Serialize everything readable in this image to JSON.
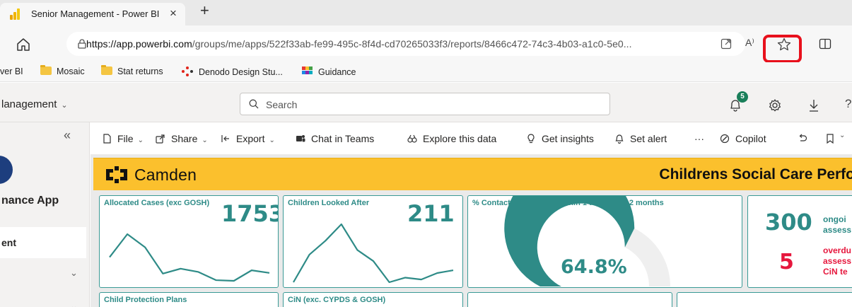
{
  "browser": {
    "tab_title": "Senior Management - Power BI",
    "tab_close": "×",
    "new_tab": "+",
    "url_domain": "https://app.powerbi.com",
    "url_path": "/groups/me/apps/522f33ab-fe99-495c-8f4d-cd70265033f3/reports/8466c472-74c3-4b03-a1c0-5e0...",
    "read_aloud": "A⁾"
  },
  "favorites": [
    {
      "label": "ver BI",
      "icon": "none"
    },
    {
      "label": "Mosaic",
      "icon": "folder-icon"
    },
    {
      "label": "Stat returns",
      "icon": "folder-icon"
    },
    {
      "label": "Denodo Design Stu...",
      "icon": "denodo-icon"
    },
    {
      "label": "Guidance",
      "icon": "grid-icon"
    }
  ],
  "pbi": {
    "workspace": "lanagement",
    "search_placeholder": "Search",
    "notification_count": "5",
    "help_fragment": "?"
  },
  "nav": {
    "collapse": "«",
    "app_name": "nance App",
    "item": "ent",
    "chevron": "⌄"
  },
  "toolbar": {
    "file": "File",
    "share": "Share",
    "export": "Export",
    "teams": "Chat in Teams",
    "explore": "Explore this data",
    "insights": "Get insights",
    "alert": "Set alert",
    "more": "···",
    "copilot": "Copilot"
  },
  "report": {
    "brand": "Camden",
    "title": "Childrens Social Care Perfo",
    "cards": {
      "allocated": {
        "title": "Allocated Cases (exc GOSH)",
        "value": "1753"
      },
      "cla": {
        "title": "Children Looked After",
        "value": "211"
      },
      "contacts": {
        "title": "% Contacts completed within 1 day in last 2 months",
        "value": "64.8%"
      },
      "assess": {
        "value_a": "300",
        "label_a1": "ongoi",
        "label_a2": "assess",
        "value_b": "5",
        "label_b1": "overdu",
        "label_b2": "assess",
        "label_b3": "CiN te"
      },
      "cpp": {
        "title": "Child Protection Plans"
      },
      "cin": {
        "title": "CiN (exc. CYPDS & GOSH)"
      }
    }
  },
  "chart_data": [
    {
      "type": "line",
      "name": "allocated-sparkline",
      "values": [
        1690,
        1760,
        1720,
        1640,
        1655,
        1645,
        1620,
        1618,
        1650,
        1642
      ]
    },
    {
      "type": "line",
      "name": "cla-sparkline",
      "values": [
        195,
        225,
        240,
        258,
        230,
        218,
        195,
        200,
        198,
        205,
        208
      ]
    },
    {
      "type": "gauge",
      "name": "contacts-gauge",
      "value": 64.8,
      "min": 0,
      "max": 100
    }
  ],
  "colors": {
    "accent": "#2e8b87",
    "banner": "#fbc02d",
    "alert_red": "#e6173d",
    "highlight": "#e8101c"
  }
}
